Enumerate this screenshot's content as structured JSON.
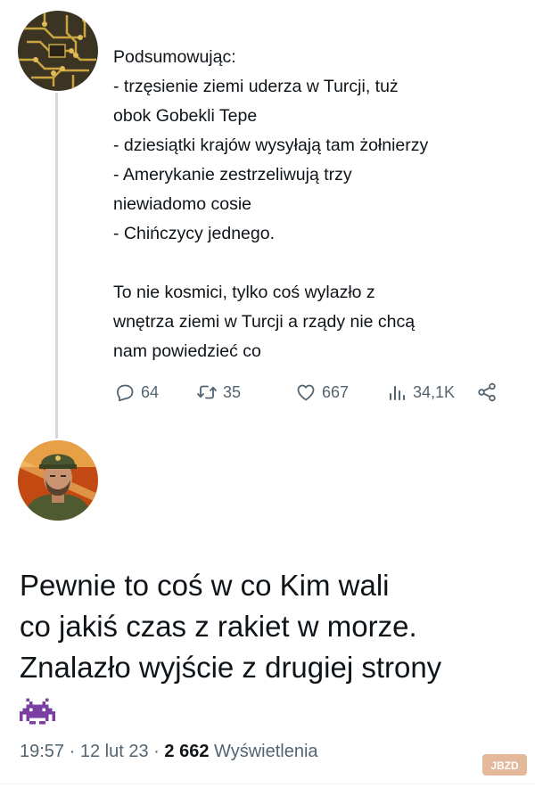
{
  "tweet1": {
    "lines": [
      "Podsumowując:",
      "- trzęsienie ziemi uderza w Turcji, tuż",
      "obok Gobekli Tepe",
      "- dziesiątki krajów wysyłają tam żołnierzy",
      "- Amerykanie zestrzeliwują trzy",
      "niewiadomo cosie",
      "- Chińczycy jednego.",
      "",
      "To nie kosmici, tylko coś wylazło z",
      "wnętrza ziemi w Turcji a rządy nie chcą",
      "nam powiedzieć co"
    ],
    "actions": {
      "replies": "64",
      "retweets": "35",
      "likes": "667",
      "views": "34,1K"
    },
    "icons": {
      "reply": "reply-icon",
      "retweet": "retweet-icon",
      "like": "heart-icon",
      "views": "bar-chart-icon",
      "share": "share-icon"
    }
  },
  "tweet2": {
    "lines": [
      "Pewnie to coś w co Kim wali",
      "co jakiś czas z rakiet w morze.",
      "Znalazło wyjście z drugiej strony"
    ],
    "emoji": "space-invader-emoji",
    "meta": {
      "time": "19:57",
      "separator": "·",
      "date": "12 lut 23",
      "views_count": "2 662",
      "views_label": "Wyświetlenia"
    }
  },
  "watermark": "JBZD",
  "colors": {
    "text": "#0f1419",
    "secondary": "#536471",
    "thread_line": "#cfd9de",
    "invader": "#7b3fa3"
  }
}
